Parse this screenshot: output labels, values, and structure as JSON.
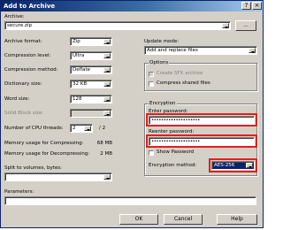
{
  "window": {
    "title": "Add to Archive"
  },
  "archive": {
    "label": "Archive:",
    "value": "secure.zip",
    "browse_label": "..."
  },
  "left": {
    "format": {
      "label": "Archive format:",
      "value": "Zip"
    },
    "level": {
      "label": "Compression level:",
      "value": "Ultra"
    },
    "method": {
      "label": "Compression method:",
      "value": "Deflate"
    },
    "dict": {
      "label": "Dictionary size:",
      "value": "32 KB"
    },
    "word": {
      "label": "Word size:",
      "value": "128"
    },
    "solid": {
      "label": "Solid Block size:",
      "value": ""
    },
    "cpu": {
      "label": "Number of CPU threads:",
      "value": "2",
      "of": "/ 2"
    },
    "mem_comp": {
      "label": "Memory usage for Compressing:",
      "value": "68 MB"
    },
    "mem_decomp": {
      "label": "Memory usage for Decompressing:",
      "value": "2 MB"
    },
    "split": {
      "label": "Split to volumes, bytes:",
      "value": ""
    },
    "params": {
      "label": "Parameters:",
      "value": ""
    }
  },
  "right": {
    "update": {
      "label": "Update mode:",
      "value": "Add and replace files"
    },
    "options": {
      "title": "Options",
      "sfx_label": "Create SFX archive",
      "shared_label": "Compress shared files"
    },
    "encryption": {
      "title": "Encryption",
      "enter_label": "Enter password:",
      "enter_value": "••••••••••••••••••••",
      "reenter_label": "Reenter password:",
      "reenter_value": "••••••••••••••••••••",
      "show_label": "Show Password",
      "method_label": "Encryption method:",
      "method_value": "AES-256"
    }
  },
  "buttons": {
    "ok": "OK",
    "cancel": "Cancel",
    "help": "Help"
  },
  "colors": {
    "highlight_box": "#e0201d",
    "selected": "#0a246a"
  }
}
